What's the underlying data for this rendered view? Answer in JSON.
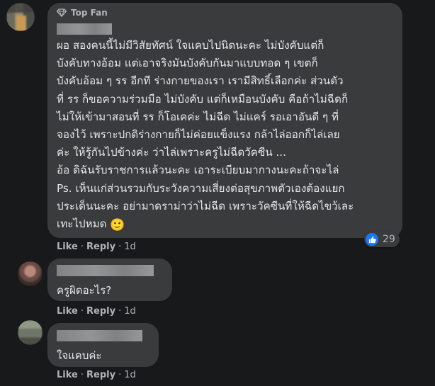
{
  "comments": [
    {
      "badge": "Top Fan",
      "text": "ผอ สองคนนี้ไม่มีวิสัยทัศน์ ใจแคบไปนิดนะคะ ไม่บังคับแต่ก็\nบังคับทางอ้อม แต่เอาจริงมันบังคับกันมาแบบทอด ๆ เขตก็\nบังคับอ้อม ๆ รร อีกที ร่างกายของเรา เรามีสิทธิ์เลือกค่ะ ส่วนตัว\nที่ รร ก็ขอความร่วมมือ ไม่บังคับ แต่ก็เหมือนบังคับ คือถ้าไม่ฉีดก็\nไม่ให้เข้ามาสอนที่ รร ก็โอเคค่ะ ไม่ฉีด ไม่แคร์ รอเอาอันดี ๆ ที่\nจองไว้ เพราะปกติร่างกายก็ไม่ค่อยแข็งแรง กล้าไล่ออกก็ไล่เลย\nค่ะ ให้รู้กันไปข้างค่ะ ว่าไล่เพราะครูไม่ฉีดวัคซีน ...\nอ้อ ดิฉันรับราชการแล้วนะคะ เอาระเบียบมากางนะคะถ้าจะไล่\nPs. เห็นแก่ส่วนรวมกับระวังความเสี่ยงต่อสุขภาพตัวเองต้องแยก\nประเด็นนะคะ อย่ามาดราม่าว่าไม่ฉีด เพราะวัคซีนที่ให้ฉีดไขว้เละ\nเทะไปหมด",
      "emoji": "🙂",
      "reaction_count": "29",
      "like_label": "Like",
      "reply_label": "Reply",
      "time": "1d"
    },
    {
      "text": "ครูผิดอะไร?",
      "like_label": "Like",
      "reply_label": "Reply",
      "time": "1d"
    },
    {
      "text": "ใจแคบค่ะ",
      "like_label": "Like",
      "reply_label": "Reply",
      "time": "1d"
    }
  ],
  "colors": {
    "background": "#18191a",
    "bubble": "#3a3b3c",
    "text": "#e4e6eb",
    "secondary_text": "#b0b3b8",
    "like_blue": "#1877f2"
  },
  "icons": {
    "badge": "diamond-icon",
    "reaction": "thumbs-up-icon",
    "emoji": "smile-emoji"
  }
}
